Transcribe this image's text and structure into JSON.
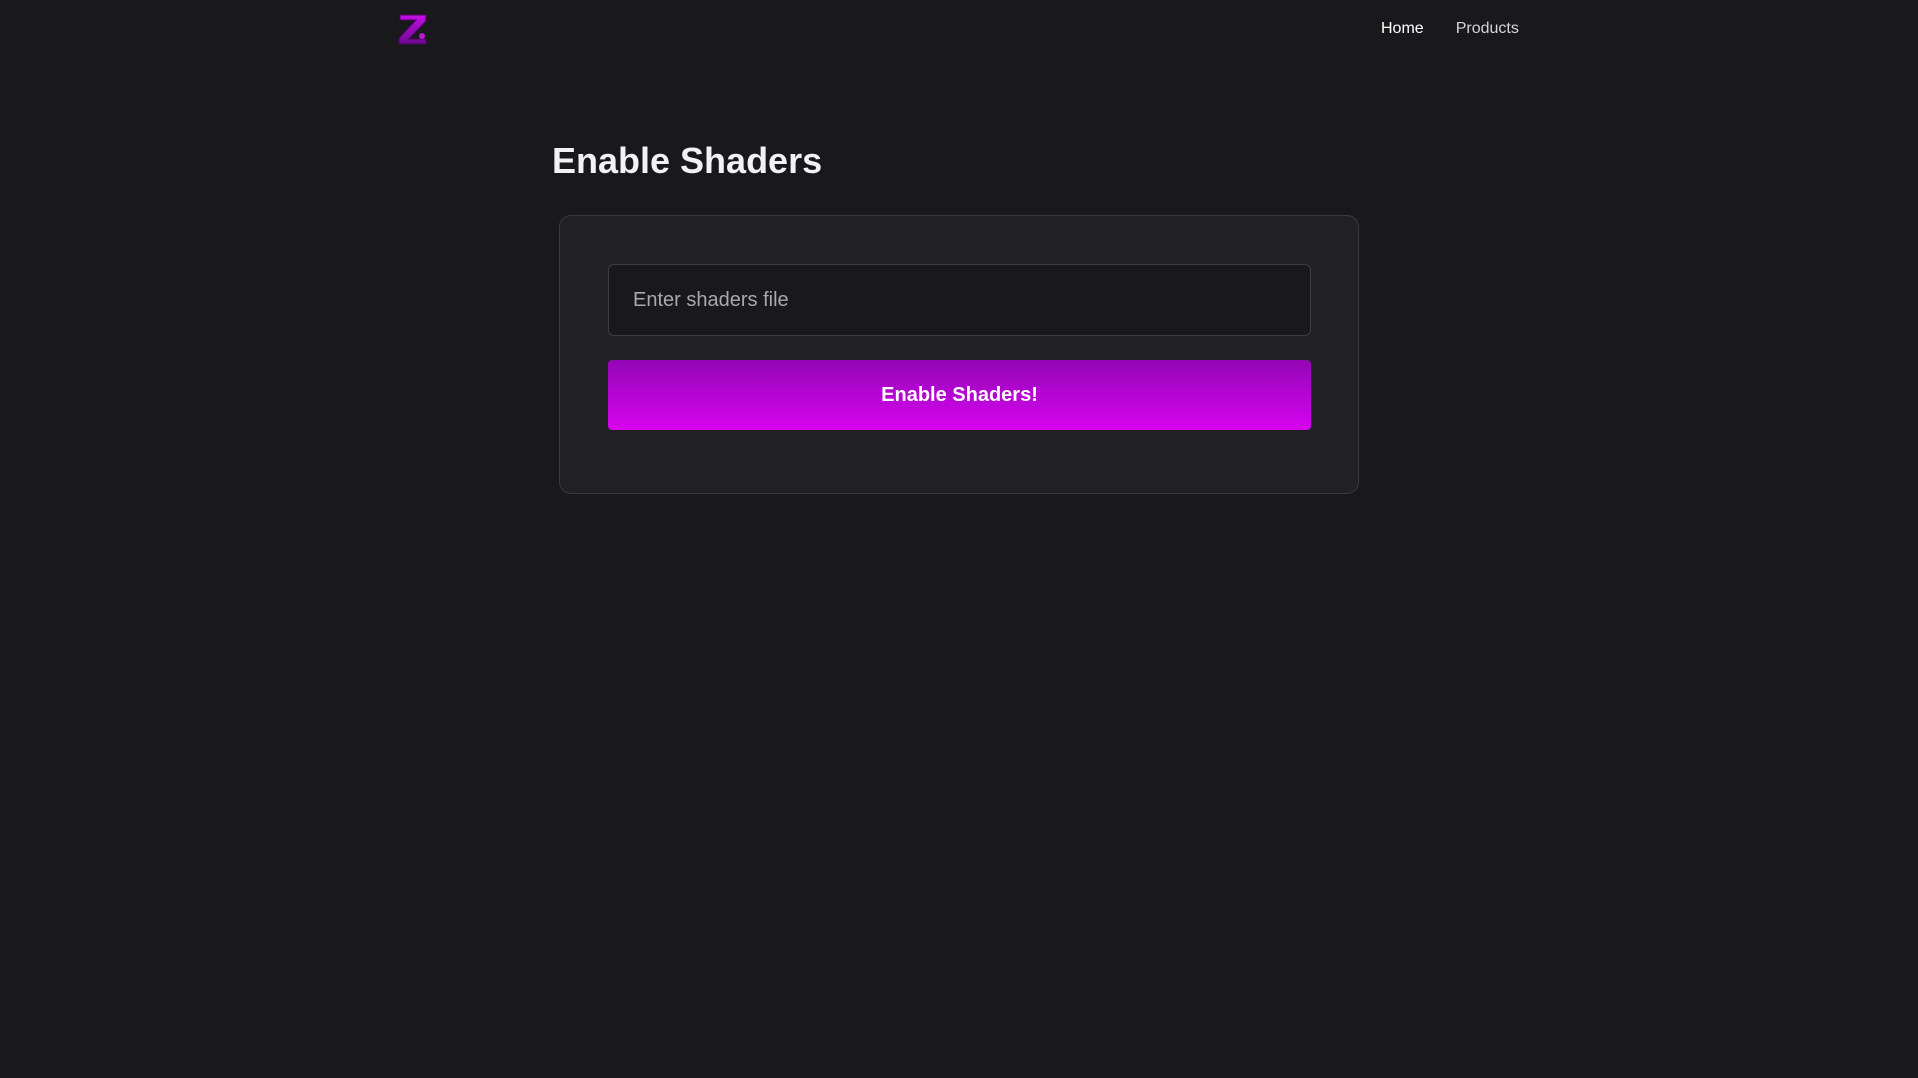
{
  "brand": {
    "logo_letter": "Z",
    "logo_icon": "purple-z-logo",
    "accent_color": "#b208d4"
  },
  "nav": {
    "links": [
      {
        "label": "Home",
        "active": true
      },
      {
        "label": "Products",
        "active": false
      }
    ]
  },
  "main": {
    "title": "Enable Shaders",
    "form": {
      "input": {
        "value": "",
        "placeholder": "Enter shaders file"
      },
      "submit_label": "Enable Shaders!"
    }
  },
  "colors": {
    "background": "#19191b",
    "card_background": "#212123",
    "button_gradient_top": "#9306b5",
    "button_gradient_bottom": "#d704ef"
  }
}
